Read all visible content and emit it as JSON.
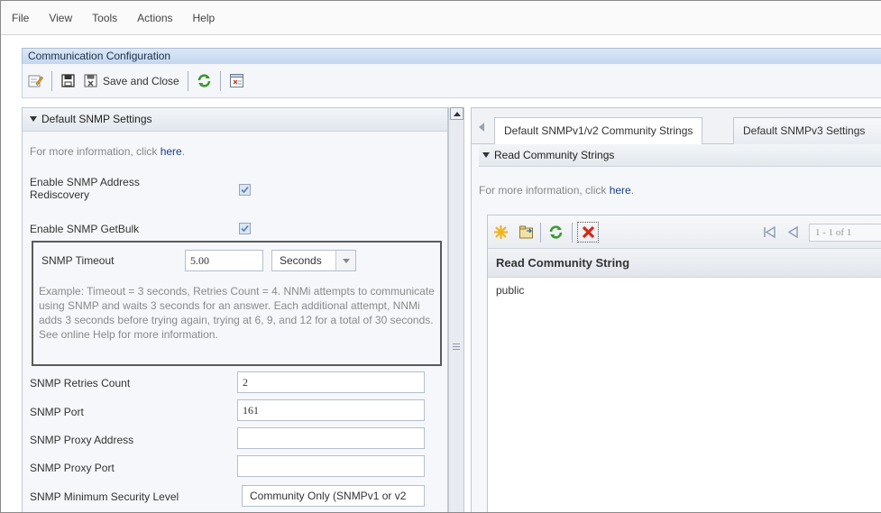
{
  "menu": [
    "File",
    "View",
    "Tools",
    "Actions",
    "Help"
  ],
  "window": {
    "title": "Communication Configuration"
  },
  "toolbar": {
    "save_close_label": "Save and Close"
  },
  "left": {
    "section_title": "Default SNMP Settings",
    "info_prefix": "For more information, click ",
    "info_link": "here",
    "info_suffix": ".",
    "fields": {
      "rediscovery_label_1": "Enable SNMP Address",
      "rediscovery_label_2": "Rediscovery",
      "getbulk_label": "Enable SNMP GetBulk",
      "timeout_label": "SNMP Timeout",
      "timeout_value": "5.00",
      "timeout_unit": "Seconds",
      "timeout_example": "Example: Timeout = 3 seconds, Retries Count = 4. NNMi attempts to communicate using SNMP and waits 3 seconds for an answer. Each additional attempt, NNMi adds 3 seconds before trying again, trying at 6, 9, and 12 for a total of 30 seconds. See online Help for more information.",
      "retries_label": "SNMP Retries Count",
      "retries_value": "2",
      "port_label": "SNMP Port",
      "port_value": "161",
      "proxy_address_label": "SNMP Proxy Address",
      "proxy_address_value": "",
      "proxy_port_label": "SNMP Proxy Port",
      "proxy_port_value": "",
      "min_security_label": "SNMP Minimum Security Level",
      "min_security_value": "Community Only (SNMPv1 or v2"
    }
  },
  "right": {
    "tabs": [
      "Default SNMPv1/v2 Community Strings",
      "Default SNMPv3 Settings"
    ],
    "section_title": "Read Community Strings",
    "info_prefix": "For more information, click ",
    "info_link": "here",
    "info_suffix": ".",
    "pager_text": "1 - 1 of 1",
    "grid": {
      "column_header": "Read Community String",
      "rows": [
        "public"
      ]
    }
  },
  "colors": {
    "title_bar": "#c4d7ee",
    "link": "#1a3f8a",
    "refresh_green": "#3a9a2c",
    "delete_red": "#d12a1a",
    "new_star": "#f0b41e"
  },
  "icons": [
    "edit-icon",
    "save-icon",
    "save-close-icon",
    "refresh-icon",
    "properties-icon",
    "new-star-icon",
    "open-icon",
    "delete-icon",
    "first-page-icon",
    "previous-page-icon"
  ]
}
